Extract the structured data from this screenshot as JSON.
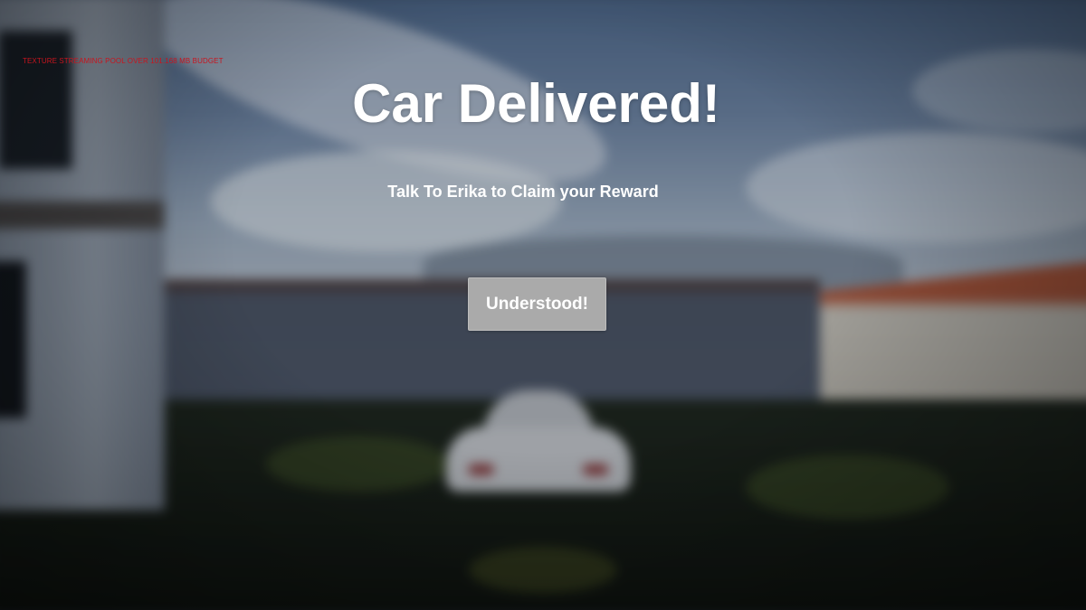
{
  "debug": {
    "warning": "TEXTURE STREAMING POOL OVER 101.168 MB BUDGET",
    "color": "#c8141e"
  },
  "dialog": {
    "title": "Car Delivered!",
    "message": "Talk To Erika to Claim your Reward",
    "confirm_label": "Understood!"
  },
  "colors": {
    "text": "#ffffff",
    "button_bg": "#aaaaaa"
  }
}
